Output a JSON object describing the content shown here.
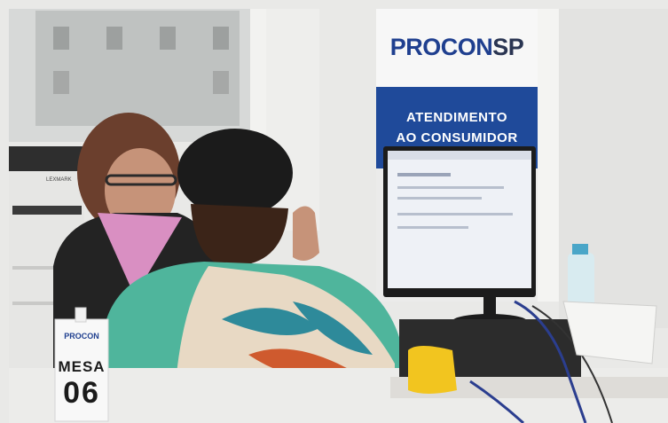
{
  "banner": {
    "logo_part1": "PROCON",
    "logo_part2": "SP",
    "line1": "ATENDIMENTO",
    "line2": "AO CONSUMIDOR",
    "brand_blue": "#1f4a9a"
  },
  "desk_sign": {
    "logo": "PROCON",
    "label": "MESA",
    "number": "06"
  },
  "printer": {
    "brand": "LEXMARK"
  }
}
